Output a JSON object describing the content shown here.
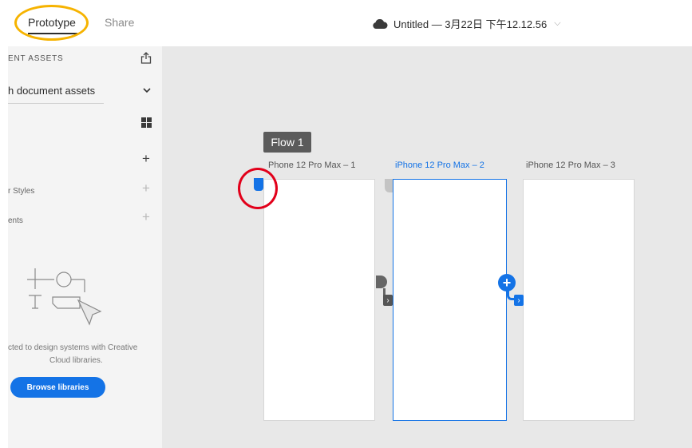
{
  "topbar": {
    "tabs": [
      {
        "label": "Prototype",
        "active": true
      },
      {
        "label": "Share",
        "active": false
      }
    ],
    "document_title": "Untitled — 3月22日 下午12.12.56",
    "cloud_icon": "cloud-icon",
    "title_chevron": "⌵"
  },
  "panel": {
    "header": "ENT ASSETS",
    "dropdown_label": "h document assets",
    "dropdown_chevron": "❯",
    "add_symbol": "+",
    "styles_label": "r Styles",
    "components_label": "ents",
    "empty_text_line1": "cted to design systems with Creative",
    "empty_text_line2": "Cloud libraries.",
    "browse_button": "Browse libraries"
  },
  "canvas": {
    "flow_label": "Flow 1",
    "artboards": [
      {
        "title": "Phone 12 Pro Max – 1",
        "selected": false
      },
      {
        "title": "iPhone 12 Pro Max – 2",
        "selected": true
      },
      {
        "title": "iPhone 12 Pro Max – 3",
        "selected": false
      }
    ],
    "add_interaction_symbol": "+",
    "arrow_symbol": "›"
  },
  "colors": {
    "accent_blue": "#1473e6",
    "highlight_orange": "#f6b300",
    "highlight_red": "#e2001a",
    "canvas_bg": "#e8e8e8",
    "panel_bg": "#f4f4f4"
  }
}
